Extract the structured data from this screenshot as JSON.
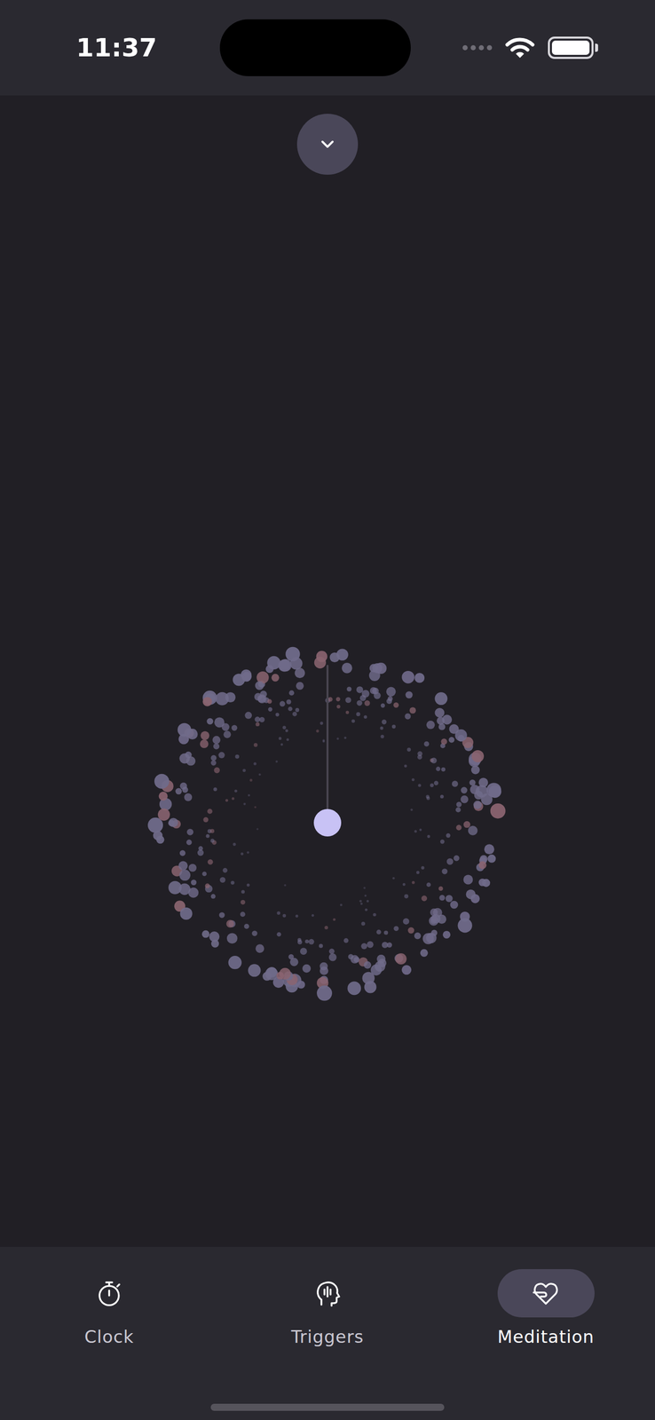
{
  "status_bar": {
    "time": "11:37",
    "battery": {
      "level": 1
    }
  },
  "tabs": [
    {
      "label": "Clock",
      "selected": false
    },
    {
      "label": "Triggers",
      "selected": false
    },
    {
      "label": "Meditation",
      "selected": true
    }
  ]
}
